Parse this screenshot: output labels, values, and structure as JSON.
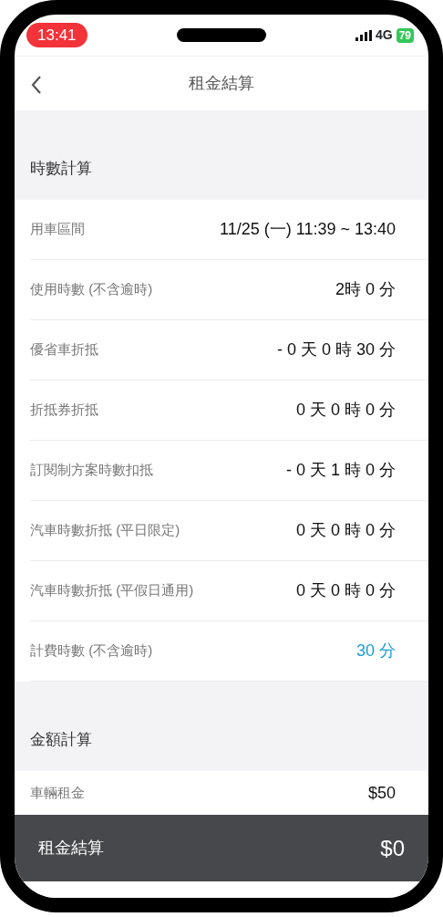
{
  "status_bar": {
    "time": "13:41",
    "network": "4G",
    "battery": "79"
  },
  "nav": {
    "title": "租金結算"
  },
  "sections": [
    {
      "title": "時數計算",
      "rows": [
        {
          "label": "用車區間",
          "value": "11/25 (一) 11:39 ~ 13:40",
          "accent": false
        },
        {
          "label": "使用時數 (不含逾時)",
          "value": "2時 0 分",
          "accent": false
        },
        {
          "label": "優省車折抵",
          "value": "- 0 天 0 時 30 分",
          "accent": false
        },
        {
          "label": "折抵券折抵",
          "value": "0 天 0 時 0 分",
          "accent": false
        },
        {
          "label": "訂閱制方案時數扣抵",
          "value": "- 0 天 1 時 0 分",
          "accent": false
        },
        {
          "label": "汽車時數折抵 (平日限定)",
          "value": "0 天 0 時 0 分",
          "accent": false
        },
        {
          "label": "汽車時數折抵 (平假日通用)",
          "value": "0 天 0 時 0 分",
          "accent": false
        },
        {
          "label": "計費時數 (不含逾時)",
          "value": "30 分",
          "accent": true
        }
      ]
    },
    {
      "title": "金額計算",
      "rows": [
        {
          "label": "車輛租金",
          "value": "$50",
          "accent": false
        }
      ]
    }
  ],
  "footer": {
    "label": "租金結算",
    "amount": "$0"
  }
}
